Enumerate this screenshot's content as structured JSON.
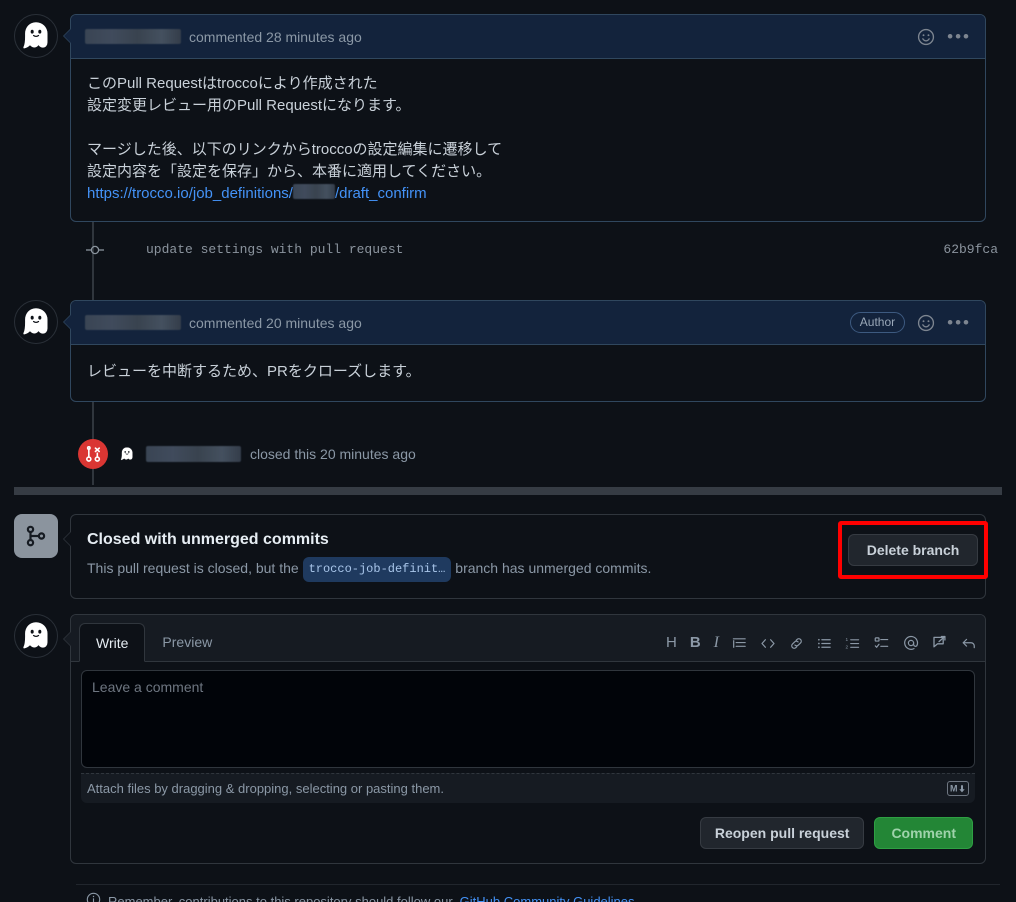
{
  "comments": [
    {
      "author_redacted": true,
      "action_text": "commented 28 minutes ago",
      "has_author_badge": false,
      "body_lines": [
        "このPull Requestはtroccoにより作成された",
        "設定変更レビュー用のPull Requestになります。",
        "",
        "マージした後、以下のリンクからtroccoの設定編集に遷移して",
        "設定内容を「設定を保存」から、本番に適用してください。"
      ],
      "link_prefix": "https://trocco.io/job_definitions/",
      "link_suffix": "/draft_confirm"
    },
    {
      "author_redacted": true,
      "action_text": "commented 20 minutes ago",
      "has_author_badge": true,
      "author_badge": "Author",
      "body_lines": [
        "レビューを中断するため、PRをクローズします。"
      ]
    }
  ],
  "commit": {
    "message": "update settings with pull request",
    "sha": "62b9fca"
  },
  "closed_event": {
    "text": "closed this 20 minutes ago"
  },
  "merge_status": {
    "title": "Closed with unmerged commits",
    "desc_before": "This pull request is closed, but the",
    "branch": "trocco-job-definit…",
    "desc_after": "branch has unmerged commits.",
    "delete_button": "Delete branch",
    "highlight_color": "#ff0000"
  },
  "composer": {
    "tabs": [
      {
        "label": "Write",
        "active": true
      },
      {
        "label": "Preview",
        "active": false
      }
    ],
    "toolbar": [
      "heading-icon",
      "bold-icon",
      "italic-icon",
      "quote-icon",
      "code-icon",
      "link-icon",
      "unordered-list-icon",
      "ordered-list-icon",
      "task-list-icon",
      "mention-icon",
      "saved-reply-icon",
      "reference-icon"
    ],
    "toolbar_labels": {
      "heading": "H",
      "bold": "B",
      "italic": "I"
    },
    "textarea_placeholder": "Leave a comment",
    "textarea_value": "",
    "attach_text": "Attach files by dragging & dropping, selecting or pasting them.",
    "markdown_badge": "M",
    "reopen_button": "Reopen pull request",
    "comment_button": "Comment"
  },
  "footer": {
    "note_before": "Remember, contributions to this repository should follow our",
    "note_link": "GitHub Community Guidelines",
    "note_after": "."
  },
  "colors": {
    "page_bg": "#0d1117",
    "comment_header_bg": "#13233c",
    "comment_border": "#30475e",
    "closed_icon": "#da3633",
    "green_button": "#238636",
    "link": "#4493f8"
  }
}
